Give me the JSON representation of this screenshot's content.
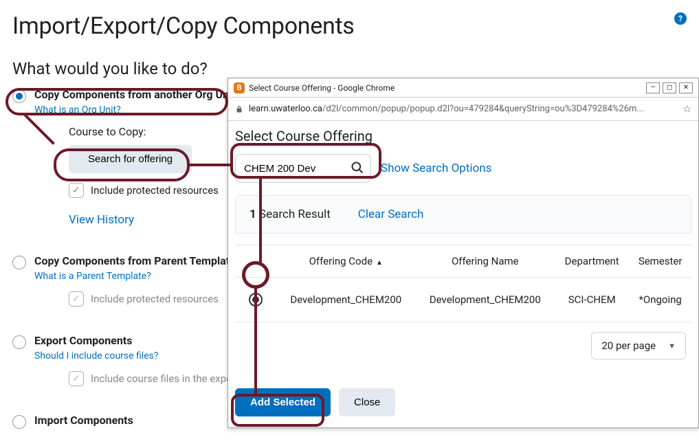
{
  "header": {
    "page_title": "Import/Export/Copy Components",
    "subheading": "What would you like to do?",
    "help_glyph": "?"
  },
  "options": {
    "copy_org_unit": {
      "label": "Copy Components from another Org Unit",
      "helper": "What is an Org Unit?",
      "course_to_copy_label": "Course to Copy:",
      "search_button": "Search for offering",
      "include_protected": "Include protected resources",
      "view_history": "View History"
    },
    "copy_parent": {
      "label": "Copy Components from Parent Template",
      "helper": "What is a Parent Template?",
      "include_protected": "Include protected resources"
    },
    "export": {
      "label": "Export Components",
      "helper": "Should I include course files?",
      "include_files": "Include course files in the expo"
    },
    "import": {
      "label": "Import Components"
    }
  },
  "popup": {
    "window_title": "Select Course Offering - Google Chrome",
    "b_glyph": "B",
    "address_host": "learn.uwaterloo.ca",
    "address_path": "/d2l/common/popup/popup.d2l?ou=479284&queryString=ou%3D479284%26m...",
    "heading": "Select Course Offering",
    "search_value": "CHEM 200 Dev",
    "show_options": "Show Search Options",
    "results_count_n": "1",
    "results_count_text": " Search Result",
    "clear_search": "Clear Search",
    "columns": {
      "code": "Offering Code",
      "name": "Offering Name",
      "dept": "Department",
      "sem": "Semester"
    },
    "rows": [
      {
        "code": "Development_CHEM200",
        "name": "Development_CHEM200",
        "dept": "SCI-CHEM",
        "sem": "*Ongoing"
      }
    ],
    "pager": "20 per page",
    "add_selected": "Add Selected",
    "close": "Close",
    "window_buttons": {
      "min": "—",
      "max": "◻",
      "close": "✕"
    }
  }
}
